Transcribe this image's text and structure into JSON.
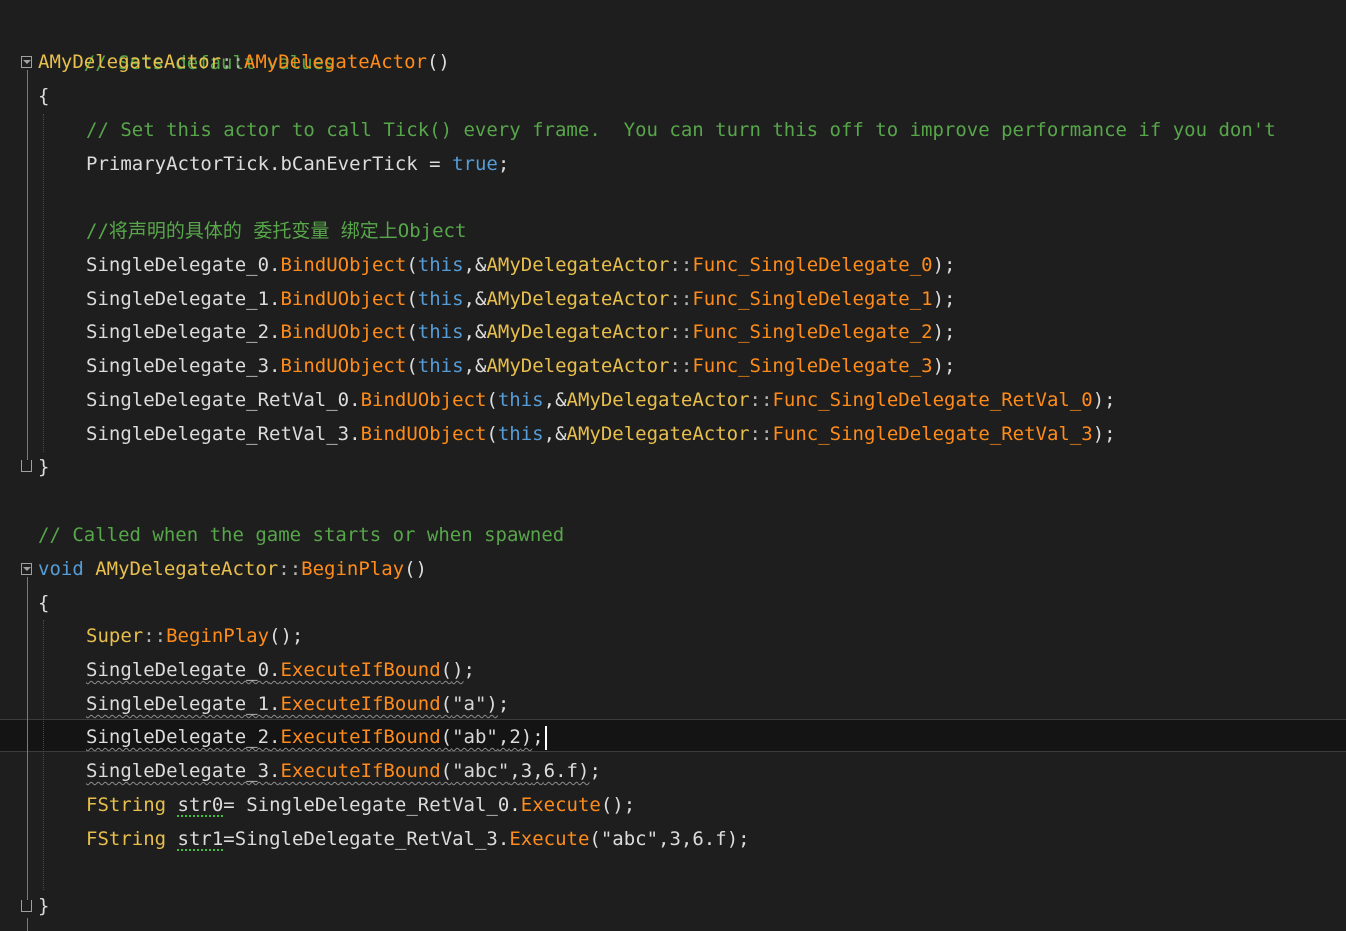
{
  "lines": {
    "l1": "// Sets default values",
    "l2_class": "AMyDelegateActor",
    "l2_sep": "::",
    "l2_fn": "AMyDelegateActor",
    "l2_paren": "()",
    "brace_open": "{",
    "brace_close": "}",
    "l4": "// Set this actor to call Tick() every frame.  You can turn this off to improve performance if you don't",
    "l5_obj": "PrimaryActorTick.bCanEverTick",
    "l5_eq": " = ",
    "l5_val": "true",
    "l5_end": ";",
    "l7": "//将声明的具体的 委托变量 绑定上Object",
    "bind": [
      {
        "var": "SingleDelegate_0",
        "method": "BindUObject",
        "fn": "Func_SingleDelegate_0"
      },
      {
        "var": "SingleDelegate_1",
        "method": "BindUObject",
        "fn": "Func_SingleDelegate_1"
      },
      {
        "var": "SingleDelegate_2",
        "method": "BindUObject",
        "fn": "Func_SingleDelegate_2"
      },
      {
        "var": "SingleDelegate_3",
        "method": "BindUObject",
        "fn": "Func_SingleDelegate_3"
      },
      {
        "var": "SingleDelegate_RetVal_0",
        "method": "BindUObject",
        "fn": "Func_SingleDelegate_RetVal_0"
      },
      {
        "var": "SingleDelegate_RetVal_3",
        "method": "BindUObject",
        "fn": "Func_SingleDelegate_RetVal_3"
      }
    ],
    "this_kw": "this",
    "amp_class": "AMyDelegateActor",
    "l17": "// Called when the game starts or when spawned",
    "l18_void": "void",
    "l18_class": "AMyDelegateActor",
    "l18_fn": "BeginPlay",
    "l20_super": "Super",
    "l20_fn": "BeginPlay",
    "exec": [
      {
        "var": "SingleDelegate_0",
        "method": "ExecuteIfBound",
        "args": []
      },
      {
        "var": "SingleDelegate_1",
        "method": "ExecuteIfBound",
        "args": [
          "\"a\""
        ]
      },
      {
        "var": "SingleDelegate_2",
        "method": "ExecuteIfBound",
        "args": [
          "\"ab\"",
          "2"
        ]
      },
      {
        "var": "SingleDelegate_3",
        "method": "ExecuteIfBound",
        "args": [
          "\"abc\"",
          "3",
          "6.f"
        ]
      }
    ],
    "l25_type": "FString",
    "l25_var": "str0",
    "l25_rhs": "SingleDelegate_RetVal_0",
    "l25_method": "Execute",
    "l26_type": "FString",
    "l26_var": "str1",
    "l26_rhs": "SingleDelegate_RetVal_3",
    "l26_method": "Execute",
    "l26_args": "\"abc\",3,6.f"
  },
  "colors": {
    "background": "#1e1e1e",
    "comment": "#57a64a",
    "keyword": "#569cd6",
    "type": "#e8bf4c",
    "function": "#ff8c1a",
    "plain": "#dcdcdc"
  }
}
